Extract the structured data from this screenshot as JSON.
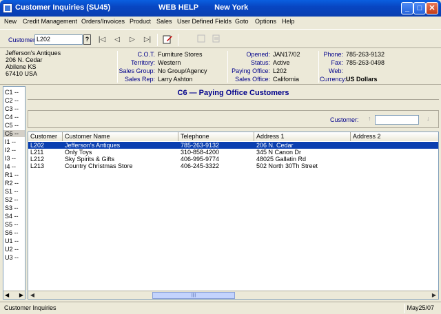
{
  "window": {
    "title": "Customer Inquiries (SU45)",
    "extra": [
      "WEB HELP",
      "New York"
    ],
    "buttons": {
      "minimize": "_",
      "maximize": "□",
      "close": "✕"
    }
  },
  "menu": [
    "New",
    "Credit Management",
    "Orders/Invoices",
    "Product",
    "Sales",
    "User Defined Fields",
    "Goto",
    "Options",
    "Help"
  ],
  "toolbar": {
    "customer_label": "Customer",
    "customer_value": "L202",
    "lookup_label": "?",
    "first": "|◁",
    "prev": "◁",
    "next": "▷",
    "last": "▷|",
    "edit_icon": "edit-icon",
    "new_icon": "new-icon",
    "copy_icon": "copy-icon"
  },
  "info": {
    "address": [
      "Jefferson's Antiques",
      "206 N. Cedar",
      "Abilene  KS",
      "67410  USA"
    ],
    "col1": [
      {
        "k": "C.O.T.",
        "v": "Furniture Stores"
      },
      {
        "k": "Territory:",
        "v": "Western"
      },
      {
        "k": "Sales Group:",
        "v": "No Group/Agency"
      },
      {
        "k": "Sales Rep:",
        "v": "Larry Ashton"
      }
    ],
    "col2": [
      {
        "k": "Opened:",
        "v": "JAN17/02"
      },
      {
        "k": "Status:",
        "v": "Active"
      },
      {
        "k": "Paying Office:",
        "v": "L202"
      },
      {
        "k": "Sales Office:",
        "v": "California"
      }
    ],
    "col3": [
      {
        "k": "Phone:",
        "v": "785-263-9132"
      },
      {
        "k": "Fax:",
        "v": "785-263-0498"
      },
      {
        "k": "Web:",
        "v": ""
      },
      {
        "k": "Currency:",
        "v": "US Dollars"
      }
    ]
  },
  "left_tabs": [
    "C1 --",
    "C2 --",
    "C3 --",
    "C4 --",
    "C5 --",
    "C6 --",
    "I1 --",
    "I2 --",
    "I3 --",
    "I4 --",
    "R1 --",
    "R2 --",
    "S1 --",
    "S2 --",
    "S3 --",
    "S4 --",
    "S5 --",
    "S6 --",
    "U1 --",
    "U2 --",
    "U3 --"
  ],
  "left_selected": 5,
  "section_title": "C6 —  Paying Office Customers",
  "search": {
    "label": "Customer:",
    "value": ""
  },
  "grid": {
    "columns": [
      "Customer",
      "Customer Name",
      "Telephone",
      "Address 1",
      "Address 2"
    ],
    "rows": [
      [
        "L202",
        "Jefferson's Antiques",
        "785-263-9132",
        "206 N. Cedar",
        ""
      ],
      [
        "L211",
        "Only Toys",
        "310-858-4200",
        "345 N Canon Dr",
        ""
      ],
      [
        "L212",
        "Sky Spirits & Gifts",
        "406-995-9774",
        "48025 Gallatin Rd",
        ""
      ],
      [
        "L213",
        "Country Christmas Store",
        "406-245-3322",
        "502 North 30Th Street",
        ""
      ]
    ],
    "selected_row": 0,
    "scroll_thumb_label": "||||"
  },
  "status": {
    "text": "Customer Inquiries",
    "date": "May25/07"
  }
}
